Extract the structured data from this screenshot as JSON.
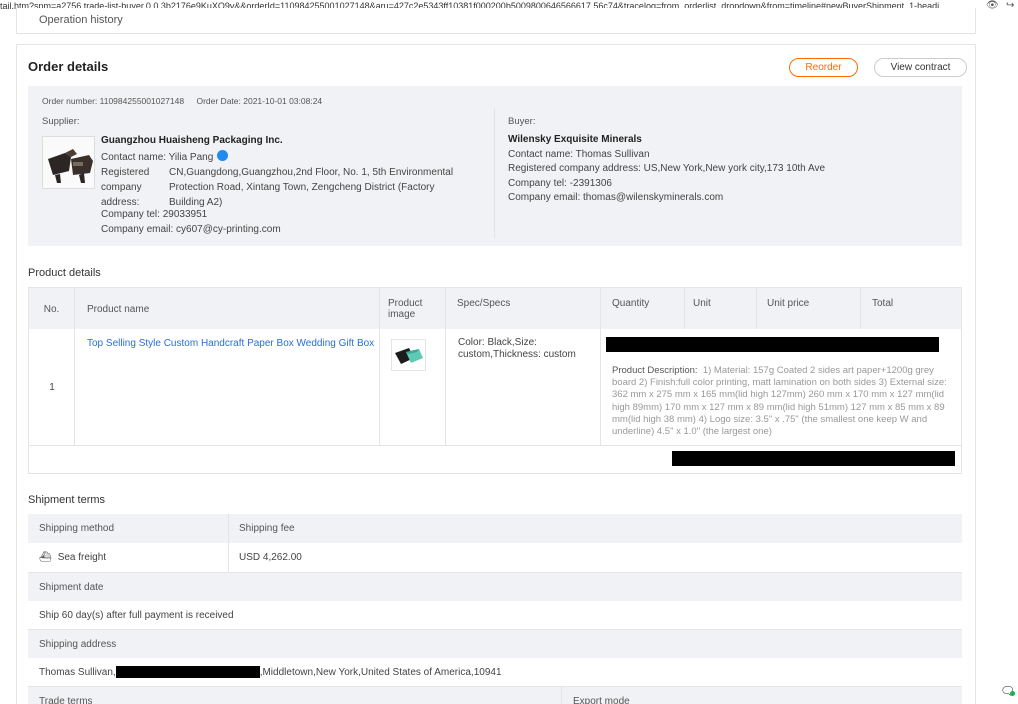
{
  "browser": {
    "url": "tail.htm?spm=a2756.trade-list-buyer.0.0.3b2176e9KuXO9v&&orderId=110984255001027148&aru=427c2e5343ff10381f000200b5009800646566617 56c74&tracelog=from_orderlist_dropdown&from=timeline#newBuyerShipment_1-headi...",
    "icons": [
      "eye-off-icon",
      "share-icon"
    ]
  },
  "previous_section": {
    "title": "Operation history"
  },
  "order": {
    "title": "Order details",
    "reorder_label": "Reorder",
    "view_contract_label": "View contract",
    "order_number": "Order number: 110984255001027148",
    "order_date": "Order Date: 2021-10-01 03:08:24"
  },
  "supplier": {
    "label": "Supplier:",
    "name": "Guangzhou Huaisheng Packaging Inc.",
    "contact": "Contact name: Yilia Pang",
    "address_label": "Registered company address:",
    "address": "CN,Guangdong,Guangzhou,2nd Floor, No. 1, 5th Environmental Protection Road, Xintang Town, Zengcheng District (Factory Building A2)",
    "tel": "Company tel: 29033951",
    "email": "Company email: cy607@cy-printing.com"
  },
  "buyer": {
    "label": "Buyer:",
    "name": "Wilensky Exquisite Minerals",
    "contact": "Contact name: Thomas Sullivan",
    "address": "Registered company address: US,New York,New york city,173 10th Ave",
    "tel": "Company tel: -2391306",
    "email": "Company email: thomas@wilenskyminerals.com"
  },
  "product_details": {
    "title": "Product details",
    "headers": [
      "No.",
      "Product name",
      "Product image",
      "Spec/Specs",
      "Quantity",
      "Unit",
      "Unit price",
      "Total"
    ],
    "row": {
      "no": "1",
      "name": "Top Selling Style Custom Handcraft Paper Box Wedding Gift Box",
      "spec": "Color: Black,Size: custom,Thickness: custom",
      "description_label": "Product Description:",
      "description": "1) Material: 157g Coated 2 sides art paper+1200g grey board 2) Finish:full color printing, matt lamination on both sides 3) External size: 362 mm x 275 mm x 165 mm(lid high 127mm) 260 mm x 170 mm x 127 mm(lid high 89mm) 170 mm x 127 mm x 89 mm(lid high 51mm) 127 mm x 85 mm x 89 mm(lid high 38 mm) 4) Logo size: 3.5\" x .75\" (the smallest one keep W and underline) 4.5\" x 1.0\" (the largest one)"
    }
  },
  "shipment_terms": {
    "title": "Shipment terms",
    "shipping_method_label": "Shipping method",
    "shipping_fee_label": "Shipping fee",
    "shipping_method": "Sea freight",
    "shipping_fee": "USD 4,262.00",
    "shipment_date_label": "Shipment date",
    "shipment_date": "Ship 60 day(s) after full payment is received",
    "shipping_address_label": "Shipping address",
    "shipping_address_prefix": "Thomas Sullivan,",
    "shipping_address_suffix": ",Middletown,New York,United States of America,10941",
    "trade_terms_label": "Trade terms",
    "export_mode_label": "Export mode"
  },
  "colors": {
    "accent": "#ff6a00",
    "link": "#2a6dd8",
    "panel": "#f1f2f5"
  }
}
